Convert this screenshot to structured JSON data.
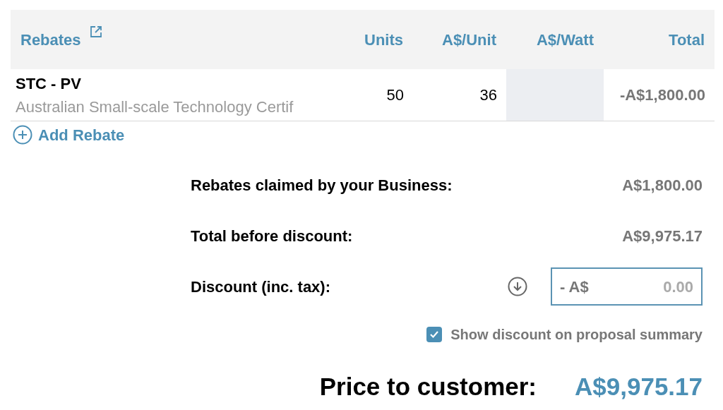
{
  "table": {
    "columns": [
      "Rebates",
      "Units",
      "A$/Unit",
      "A$/Watt",
      "Total"
    ],
    "rows": [
      {
        "name": "STC - PV",
        "description": "Australian Small-scale Technology Certif",
        "units": "50",
        "per_unit": "36",
        "total": "-A$1,800.00"
      }
    ]
  },
  "add_rebate": "Add Rebate",
  "summary": [
    {
      "label": "Rebates claimed by your Business:",
      "value": "A$1,800.00"
    },
    {
      "label": "Total before discount:",
      "value": "A$9,975.17"
    }
  ],
  "discount": {
    "label": "Discount (inc. tax):",
    "prefix": "- A$",
    "value": "0.00"
  },
  "show_discount": {
    "label": "Show discount on proposal summary",
    "checked": true
  },
  "price": {
    "label": "Price to customer:",
    "value": "A$9,975.17"
  }
}
